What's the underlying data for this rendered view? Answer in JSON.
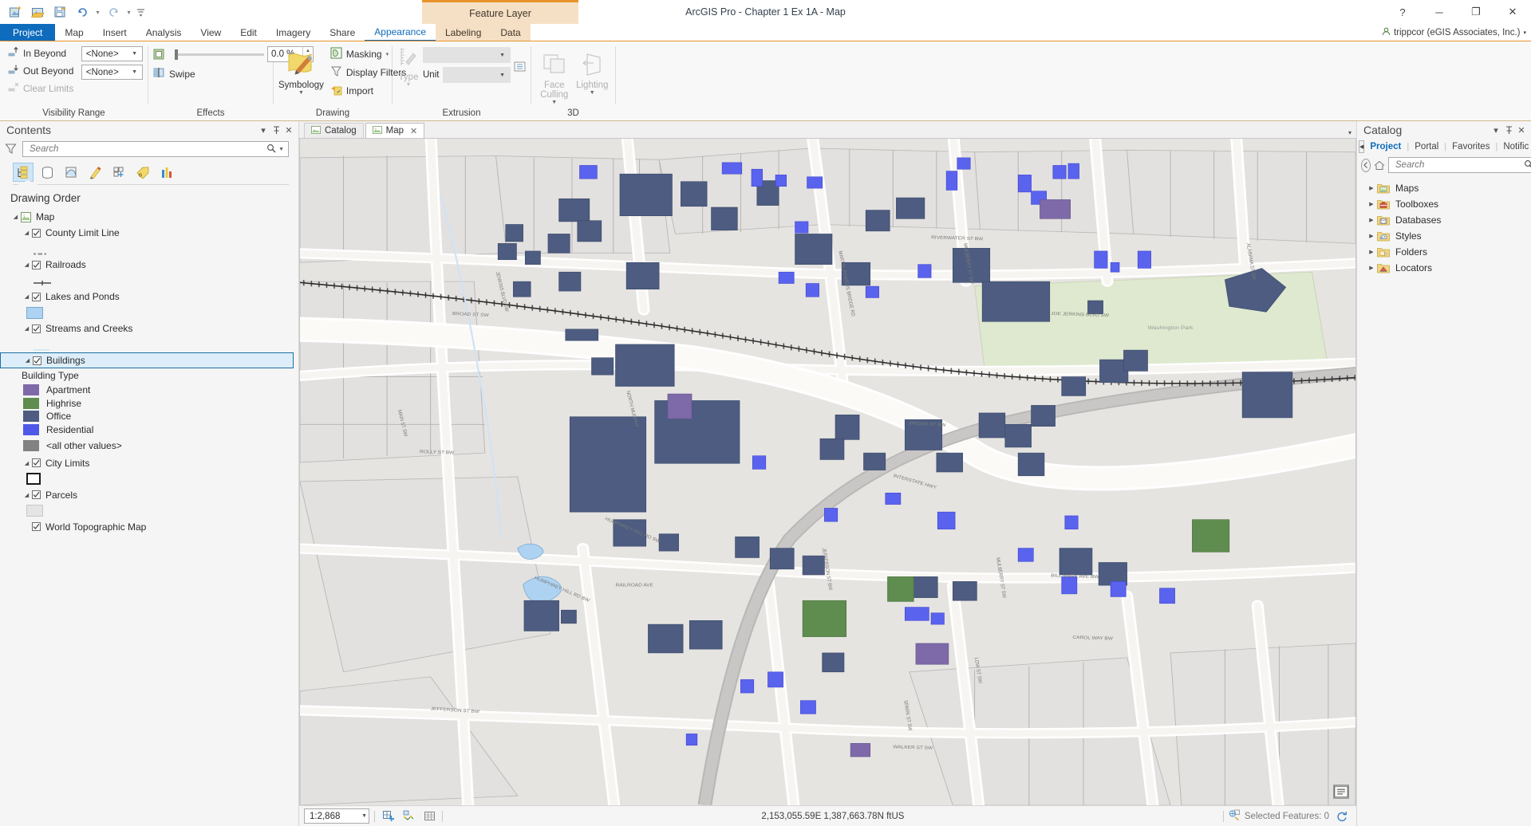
{
  "window": {
    "app_title": "ArcGIS Pro - Chapter 1 Ex 1A - Map",
    "contextual_tab_group": "Feature Layer",
    "account": "trippcor (eGIS Associates, Inc.)",
    "minimize": "─",
    "maximize": "❐",
    "close": "✕"
  },
  "quick_access": {
    "new_project": "new-project-icon",
    "open_project": "open-project-icon",
    "save_project": "save-project-icon",
    "undo": "undo-icon",
    "redo": "redo-icon",
    "customize": "customize-icon"
  },
  "ribbon_tabs": [
    {
      "label": "Project",
      "kind": "backstage"
    },
    {
      "label": "Map",
      "kind": "normal"
    },
    {
      "label": "Insert",
      "kind": "normal"
    },
    {
      "label": "Analysis",
      "kind": "normal"
    },
    {
      "label": "View",
      "kind": "normal"
    },
    {
      "label": "Edit",
      "kind": "normal"
    },
    {
      "label": "Imagery",
      "kind": "normal"
    },
    {
      "label": "Share",
      "kind": "normal"
    },
    {
      "label": "Appearance",
      "kind": "contextual",
      "active": true
    },
    {
      "label": "Labeling",
      "kind": "contextual"
    },
    {
      "label": "Data",
      "kind": "contextual"
    }
  ],
  "ribbon": {
    "groups": [
      {
        "label": "Visibility Range",
        "commands": [
          {
            "label": "In Beyond",
            "icon": "zoom-in-beyond-icon",
            "enabled": true
          },
          {
            "label": "Out Beyond",
            "icon": "zoom-out-beyond-icon",
            "enabled": true
          },
          {
            "label": "Clear Limits",
            "icon": "clear-limits-icon",
            "enabled": false
          }
        ],
        "combos": [
          {
            "name": "in-beyond-scale",
            "value": "<None>"
          },
          {
            "name": "out-beyond-scale",
            "value": "<None>"
          }
        ]
      },
      {
        "label": "Effects",
        "transparency_value": "0.0 %",
        "swipe_label": "Swipe",
        "transparency_icon": "layer-transparency-icon",
        "swipe_icon": "swipe-icon"
      },
      {
        "label": "Drawing",
        "symbology_label": "Symbology",
        "commands": [
          {
            "label": "Masking",
            "icon": "masking-icon",
            "has_menu": true
          },
          {
            "label": "Display Filters",
            "icon": "display-filters-icon",
            "has_menu": false
          },
          {
            "label": "Import",
            "icon": "import-symbology-icon",
            "has_menu": false
          }
        ]
      },
      {
        "label": "Extrusion",
        "type_label": "Type",
        "unit_label": "Unit",
        "expression_value": "",
        "unit_value": "",
        "extrusion_icon": "extrusion-ruler-icon",
        "list_icon": "extrusion-list-icon"
      },
      {
        "label": "3D",
        "commands": [
          {
            "label": "Face Culling",
            "icon": "face-culling-icon",
            "has_menu": true
          },
          {
            "label": "Lighting",
            "icon": "lighting-icon",
            "has_menu": true
          }
        ]
      }
    ]
  },
  "contents": {
    "title": "Contents",
    "search_placeholder": "Search",
    "search_value": "",
    "tool_buttons": [
      {
        "name": "list-by-drawing-order",
        "selected": true
      },
      {
        "name": "list-by-data-source",
        "selected": false
      },
      {
        "name": "list-by-selection",
        "selected": false
      },
      {
        "name": "list-by-editing",
        "selected": false
      },
      {
        "name": "list-by-snapping",
        "selected": false
      },
      {
        "name": "list-by-labeling",
        "selected": false
      },
      {
        "name": "list-by-charts",
        "selected": false
      }
    ],
    "heading": "Drawing Order",
    "map_node": "Map",
    "layers": [
      {
        "name": "County Limit Line",
        "checked": true,
        "symbol": "dashed-line",
        "color": "#808080"
      },
      {
        "name": "Railroads",
        "checked": true,
        "symbol": "railroad-line",
        "color": "#595959"
      },
      {
        "name": "Lakes and Ponds",
        "checked": true,
        "symbol": "polygon",
        "color": "#a9d0f5",
        "outline": "#6699cc"
      },
      {
        "name": "Streams and Creeks",
        "checked": true,
        "symbol": "thin-line",
        "color": "#cfe3f5"
      },
      {
        "name": "Buildings",
        "checked": true,
        "selected": true,
        "legend_title": "Building Type",
        "legend": [
          {
            "label": "Apartment",
            "color": "#7e6aa8"
          },
          {
            "label": "Highrise",
            "color": "#5f8c4f"
          },
          {
            "label": "Office",
            "color": "#4d5c80"
          },
          {
            "label": "Residential",
            "color": "#4f59e8"
          },
          {
            "label": "<all other values>",
            "color": "#828282"
          }
        ]
      },
      {
        "name": "City Limits",
        "checked": true,
        "symbol": "hollow-polygon",
        "color": "#ffffff",
        "outline": "#000000"
      },
      {
        "name": "Parcels",
        "checked": true,
        "symbol": "polygon",
        "color": "#e4e4e4",
        "outline": "#bdbdbd"
      },
      {
        "name": "World Topographic Map",
        "checked": true,
        "symbol": "none"
      }
    ]
  },
  "view_tabs": [
    {
      "label": "Catalog",
      "icon": "catalog-view-icon",
      "active": false,
      "closable": false
    },
    {
      "label": "Map",
      "icon": "map-view-icon",
      "active": true,
      "closable": true
    }
  ],
  "map": {
    "labels": [
      "RIVERWATER ST BW",
      "JOE JERKINS BLVD SW",
      "ALABAMA ST SW",
      "MULBERRY ST SW",
      "BROAD ST BW",
      "BROAD ST SW",
      "JENKINS BLVD SW",
      "MARTEL POWERS BRIDGE RD",
      "HUMPHREY HILL RD SW",
      "RAILROAD AVE",
      "JEFFERSON ST BW",
      "ROLLY ST BW",
      "BILL MARK AVE BW",
      "CAROL WAY BW",
      "WALKER ST SW",
      "SPARK ST SW",
      "LOW ST SW",
      "NORTH MURPHY",
      "ALABAMA ST SW"
    ],
    "park_label": "Washington Park",
    "basemap": "World Topographic Map"
  },
  "statusbar": {
    "scale": "1:2,868",
    "coordinates": "2,153,055.59E 1,387,663.78N ftUS",
    "selected_features": "Selected Features: 0",
    "buttons": [
      {
        "name": "add-graphics-button"
      },
      {
        "name": "measure-button"
      },
      {
        "name": "grid-button"
      }
    ],
    "refresh": "refresh-icon"
  },
  "catalog": {
    "title": "Catalog",
    "tabs": [
      {
        "label": "Project",
        "active": true
      },
      {
        "label": "Portal",
        "active": false
      },
      {
        "label": "Favorites",
        "active": false
      },
      {
        "label": "Notific",
        "active": false
      }
    ],
    "search_placeholder": "Search",
    "search_value": "",
    "back_icon": "back-arrow-icon",
    "home_icon": "home-icon",
    "items": [
      {
        "label": "Maps",
        "icon": "maps-folder-icon",
        "color": "#d8b43a"
      },
      {
        "label": "Toolboxes",
        "icon": "toolboxes-folder-icon",
        "color": "#d8b43a"
      },
      {
        "label": "Databases",
        "icon": "databases-folder-icon",
        "color": "#d8b43a"
      },
      {
        "label": "Styles",
        "icon": "styles-folder-icon",
        "color": "#d8b43a"
      },
      {
        "label": "Folders",
        "icon": "folders-folder-icon",
        "color": "#d8b43a"
      },
      {
        "label": "Locators",
        "icon": "locators-folder-icon",
        "color": "#d8b43a"
      }
    ]
  },
  "colors": {
    "accent": "#0f6cbd",
    "contextual": "#e8932a",
    "contextual_bg": "#f6e0c5"
  }
}
